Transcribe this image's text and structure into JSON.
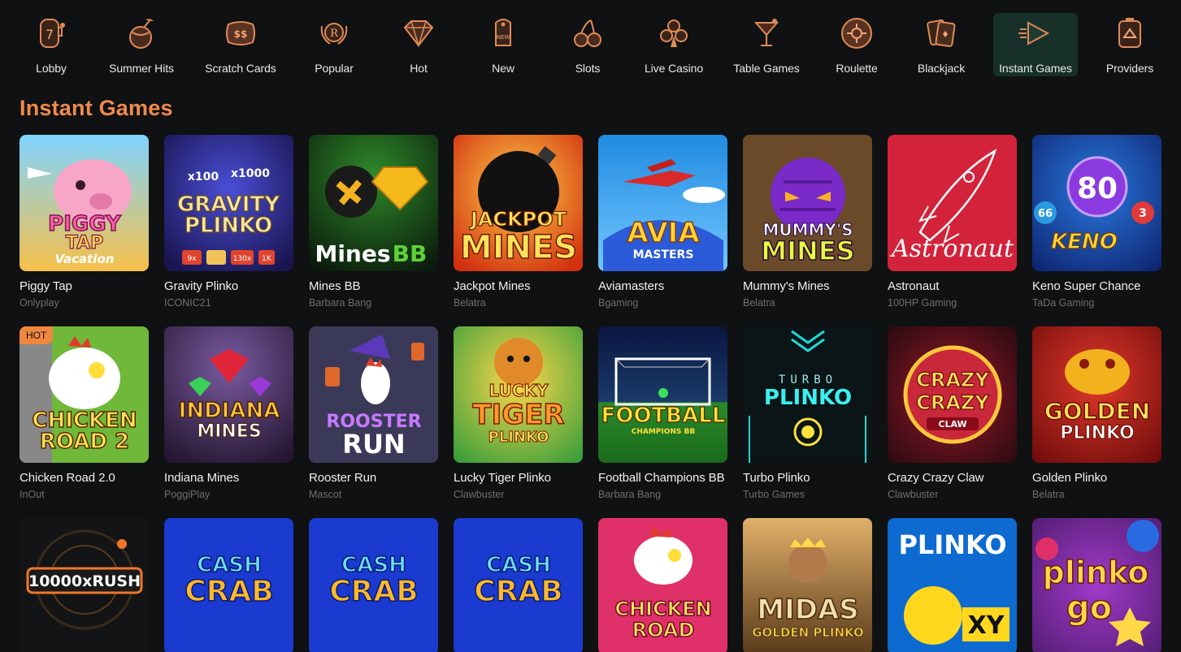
{
  "nav": {
    "items": [
      {
        "label": "Lobby",
        "icon": "slot-seven-icon"
      },
      {
        "label": "Summer Hits",
        "icon": "coconut-drink-icon"
      },
      {
        "label": "Scratch Cards",
        "icon": "scratch-card-icon"
      },
      {
        "label": "Popular",
        "icon": "laurel-crest-icon"
      },
      {
        "label": "Hot",
        "icon": "diamond-icon"
      },
      {
        "label": "New",
        "icon": "new-tag-icon"
      },
      {
        "label": "Slots",
        "icon": "cherries-icon"
      },
      {
        "label": "Live Casino",
        "icon": "clubs-suit-icon"
      },
      {
        "label": "Table Games",
        "icon": "cocktail-glass-icon"
      },
      {
        "label": "Roulette",
        "icon": "roulette-wheel-icon"
      },
      {
        "label": "Blackjack",
        "icon": "playing-cards-icon"
      },
      {
        "label": "Instant Games",
        "icon": "play-rocket-icon",
        "active": true
      },
      {
        "label": "Providers",
        "icon": "providers-box-icon"
      }
    ]
  },
  "section_title": "Instant Games",
  "games": [
    {
      "title": "Piggy Tap",
      "provider": "Onlyplay",
      "art": "PIGGY TAP Vacation"
    },
    {
      "title": "Gravity Plinko",
      "provider": "ICONIC21",
      "art": "GRAVITY PLINKO"
    },
    {
      "title": "Mines BB",
      "provider": "Barbara Bang",
      "art": "MinesBB"
    },
    {
      "title": "Jackpot Mines",
      "provider": "Belatra",
      "art": "JACKPOT MINES"
    },
    {
      "title": "Aviamasters",
      "provider": "Bgaming",
      "art": "AVIA MASTERS"
    },
    {
      "title": "Mummy's Mines",
      "provider": "Belatra",
      "art": "MUMMY'S MINES"
    },
    {
      "title": "Astronaut",
      "provider": "100HP Gaming",
      "art": "Astronaut"
    },
    {
      "title": "Keno Super Chance",
      "provider": "TaDa Gaming",
      "art": "KENO"
    },
    {
      "title": "Chicken Road 2.0",
      "provider": "InOut",
      "art": "CHICKEN ROAD 2",
      "badge": "HOT"
    },
    {
      "title": "Indiana Mines",
      "provider": "PoggiPlay",
      "art": "INDIANA MINES"
    },
    {
      "title": "Rooster Run",
      "provider": "Mascot",
      "art": "ROOSTER RUN"
    },
    {
      "title": "Lucky Tiger Plinko",
      "provider": "Clawbuster",
      "art": "LUCKY TIGER PLINKO"
    },
    {
      "title": "Football Champions BB",
      "provider": "Barbara Bang",
      "art": "FOOTBALL"
    },
    {
      "title": "Turbo Plinko",
      "provider": "Turbo Games",
      "art": "TURBO PLINKO"
    },
    {
      "title": "Crazy Crazy Claw",
      "provider": "Clawbuster",
      "art": "CRAZY CRAZY CLAW"
    },
    {
      "title": "Golden Plinko",
      "provider": "Belatra",
      "art": "GOLDEN PLINKO"
    },
    {
      "title": "",
      "provider": "",
      "art": "10000xRUSH"
    },
    {
      "title": "",
      "provider": "",
      "art": "CASH CRAB"
    },
    {
      "title": "",
      "provider": "",
      "art": "CASH CRAB"
    },
    {
      "title": "",
      "provider": "",
      "art": "CASH CRAB"
    },
    {
      "title": "",
      "provider": "",
      "art": "CHICKEN ROAD"
    },
    {
      "title": "",
      "provider": "",
      "art": "MIDAS GOLDEN PLINKO"
    },
    {
      "title": "",
      "provider": "",
      "art": "PLINKO XY"
    },
    {
      "title": "",
      "provider": "",
      "art": "plinko go"
    }
  ],
  "colors": {
    "background": "#0f1112",
    "accent": "#f08a4a",
    "active_nav": "#17302a",
    "provider_text": "#6d7073"
  }
}
